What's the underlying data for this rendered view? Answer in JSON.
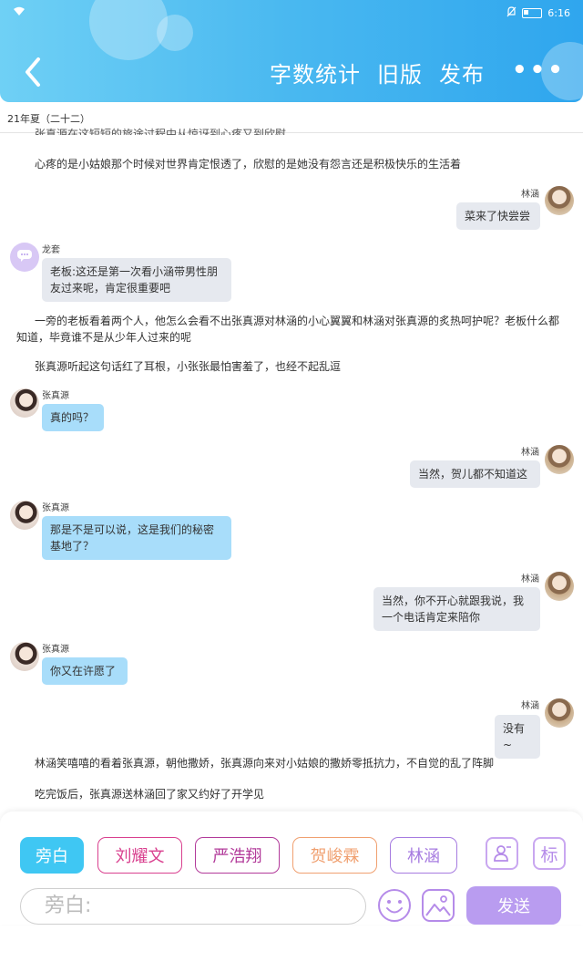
{
  "status_bar": {
    "time": "6:16"
  },
  "header": {
    "nav": [
      "字数统计",
      "旧版",
      "发布"
    ],
    "more_label": "•••"
  },
  "chapter_title": "21年夏（二十二）",
  "clipped_line": "张真源在这短短的旅途过程中从惊讶到心疼又到欣慰",
  "narration": [
    "心疼的是小姑娘那个时候对世界肯定恨透了，欣慰的是她没有怨言还是积极快乐的生活着",
    "一旁的老板看着两个人，他怎么会看不出张真源对林涵的小心翼翼和林涵对张真源的炙热呵护呢？老板什么都知道，毕竟谁不是从少年人过来的呢",
    "张真源听起这句话红了耳根，小张张最怕害羞了，也经不起乱逗",
    "林涵笑嘻嘻的看着张真源，朝他撒娇，张真源向来对小姑娘的撒娇零抵抗力，不自觉的乱了阵脚",
    "吃完饭后，张真源送林涵回了家又约好了开学见"
  ],
  "messages": [
    {
      "speaker": "林涵",
      "text": "菜来了快尝尝"
    },
    {
      "speaker": "龙套",
      "text": "老板:这还是第一次看小涵带男性朋友过来呢，肯定很重要吧"
    },
    {
      "speaker": "张真源",
      "text": "真的吗？"
    },
    {
      "speaker": "林涵",
      "text": "当然，贺儿都不知道这"
    },
    {
      "speaker": "张真源",
      "text": "那是不是可以说，这是我们的秘密基地了？"
    },
    {
      "speaker": "林涵",
      "text": "当然，你不开心就跟我说，我一个电话肯定来陪你"
    },
    {
      "speaker": "张真源",
      "text": "你又在许愿了"
    },
    {
      "speaker": "林涵",
      "text": "没有~"
    }
  ],
  "roles": [
    "旁白",
    "刘耀文",
    "严浩翔",
    "贺峻霖",
    "林涵"
  ],
  "role_colors": [
    "#3fc7f3",
    "#d9408f",
    "#b23a9a",
    "#f0a070",
    "#a67be0"
  ],
  "tool_icons": {
    "character": "person-add-icon",
    "tag_label": "标"
  },
  "input": {
    "placeholder": "旁白:"
  },
  "send_label": "发送"
}
